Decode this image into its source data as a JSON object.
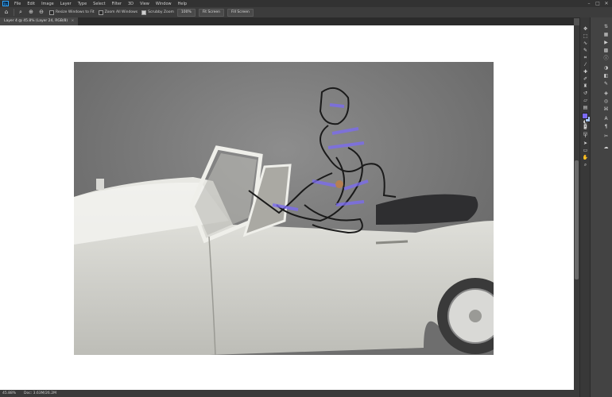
{
  "app": {
    "logo_text": "Ps"
  },
  "menubar": {
    "items": [
      "File",
      "Edit",
      "Image",
      "Layer",
      "Type",
      "Select",
      "Filter",
      "3D",
      "View",
      "Window",
      "Help"
    ]
  },
  "window_controls": {
    "minimize": "–",
    "maximize": "□",
    "close": "✕"
  },
  "options_bar": {
    "resize_windows_label": "Resize Windows to Fit",
    "zoom_all_windows_label": "Zoom All Windows",
    "scrubby_zoom_label": "Scrubby Zoom",
    "scrubby_zoom_checked": true,
    "zoom_100_label": "100%",
    "fit_screen_label": "Fit Screen",
    "fill_screen_label": "Fill Screen"
  },
  "document_tab": {
    "title": "Layer 4 @ 45.8% (Layer 24, RGB/8)"
  },
  "status": {
    "zoom": "45.88%",
    "doc_size": "Doc: 3.63M/26.2M"
  },
  "colors": {
    "foreground": "#7b6bf5",
    "background": "#a9c6ff"
  },
  "tools": [
    "move-icon",
    "marquee-icon",
    "lasso-icon",
    "quick-select-icon",
    "crop-icon",
    "eyedropper-icon",
    "healing-icon",
    "brush-icon",
    "clone-stamp-icon",
    "history-brush-icon",
    "eraser-icon",
    "gradient-icon",
    "blur-icon",
    "dodge-icon",
    "pen-icon",
    "type-icon",
    "path-select-icon",
    "rectangle-icon",
    "hand-icon",
    "zoom-icon"
  ]
}
